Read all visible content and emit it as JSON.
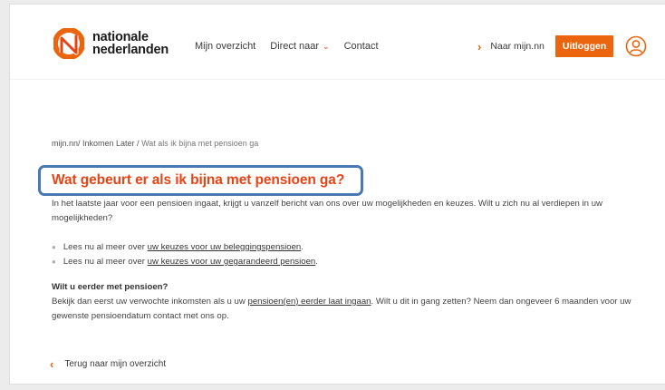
{
  "brand": {
    "name_line1": "nationale",
    "name_line2": "nederlanden",
    "accent": "#ea650d",
    "title_color": "#e64415",
    "highlight": "#4a78b3"
  },
  "nav": {
    "items": [
      {
        "label": "Mijn overzicht"
      },
      {
        "label": "Direct naar"
      },
      {
        "label": "Contact"
      }
    ],
    "naar_link": "Naar mijn.nn",
    "logout": "Uitloggen"
  },
  "breadcrumb": {
    "path": "mijn.nn/ Inkomen Later /",
    "current": " Wat als ik bijna met pensioen ga"
  },
  "title": "Wat gebeurt er als ik bijna met pensioen ga?",
  "intro": "In het laatste jaar voor een pensioen ingaat, krijgt u vanzelf bericht van ons over uw mogelijkheden en keuzes. Wilt u zich nu al verdiepen in uw mogelijkheden?",
  "bullets": [
    {
      "prefix": "Lees nu al meer over ",
      "link": "uw keuzes voor uw beleggingspensioen",
      "suffix": "."
    },
    {
      "prefix": "Lees nu al meer over ",
      "link": "uw keuzes voor uw gegarandeerd pensioen",
      "suffix": "."
    }
  ],
  "early": {
    "heading": "Wilt u eerder met pensioen?",
    "text_before": "Bekijk dan eerst uw verwochte inkomsten als u uw ",
    "link": "pensioen(en) eerder laat ingaan",
    "text_after": ". Wilt u dit in gang zetten? Neem dan ongeveer 6 maanden voor uw gewenste pensioendatum contact met ons op."
  },
  "back_link": "Terug naar mijn overzicht",
  "icons": {
    "logo": "nn-logo-icon",
    "chevron": "chevron-down-icon",
    "arrow_right": "chevron-right-icon",
    "arrow_left": "chevron-left-icon",
    "user": "user-icon"
  }
}
